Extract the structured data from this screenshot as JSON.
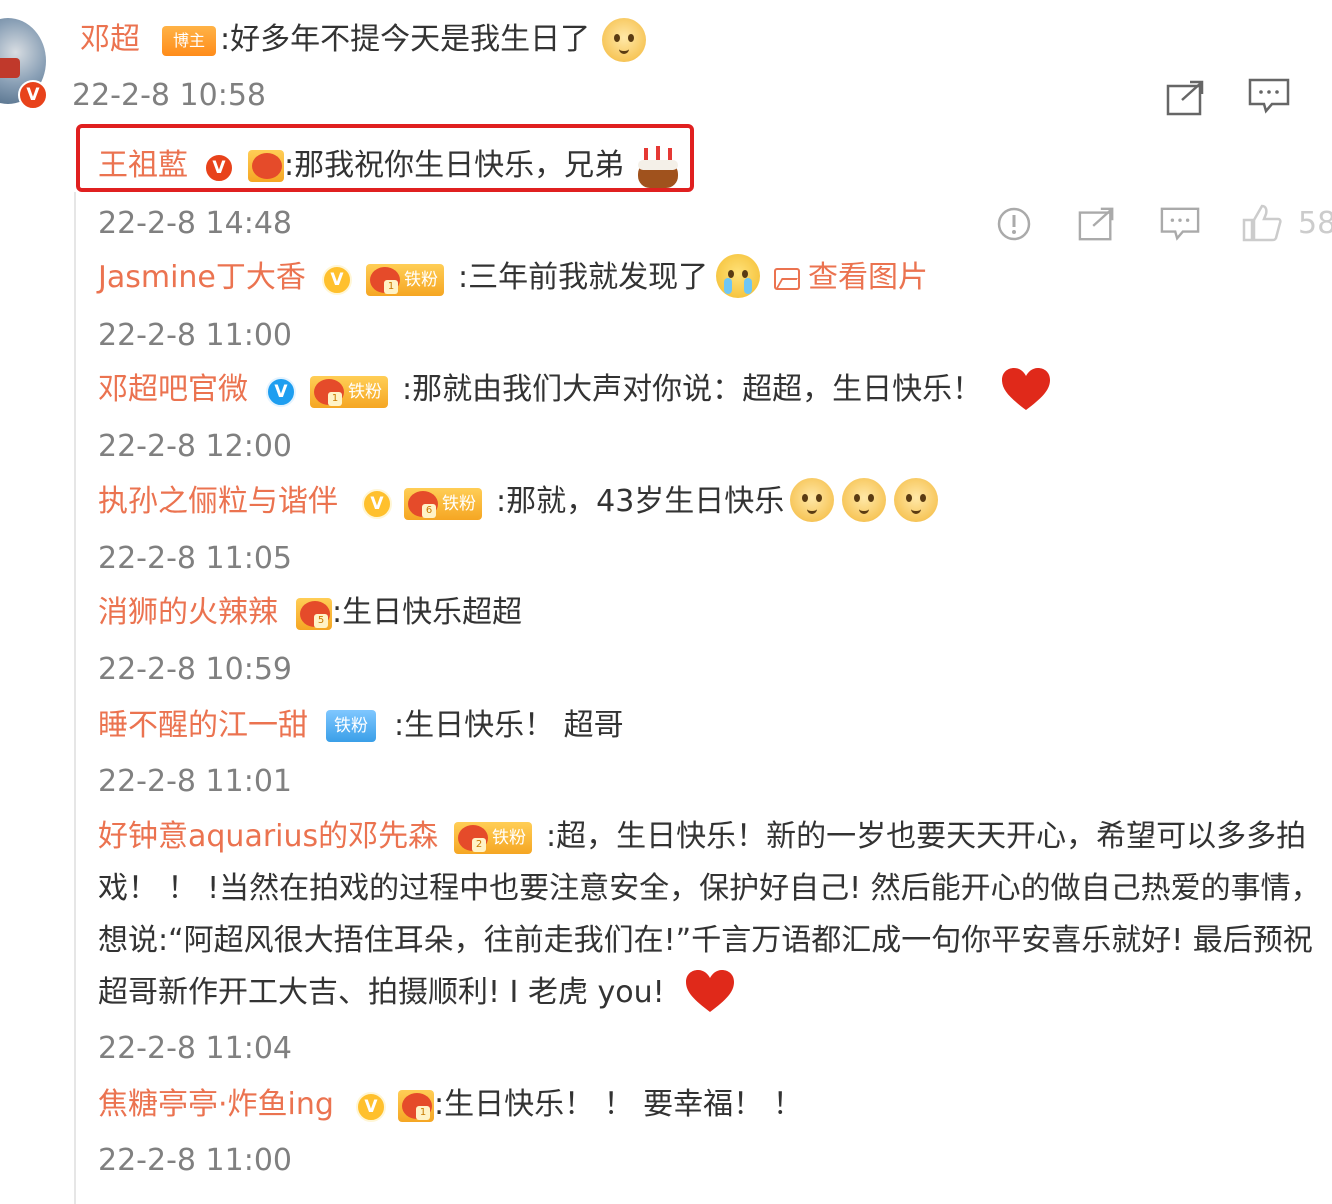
{
  "main_post": {
    "author": "邓超",
    "badge": "博主",
    "text": ":好多年不提今天是我生日了",
    "time": "22-2-8 10:58"
  },
  "highlight_reply": {
    "author": "王祖藍",
    "text": ":那我祝你生日快乐，兄弟",
    "time": "22-2-8 14:48",
    "like_count": "58"
  },
  "replies": [
    {
      "author": "Jasmine丁大香",
      "fan_badge": "铁粉",
      "fan_level": "1",
      "text": ":三年前我就发现了",
      "link": "查看图片",
      "time": "22-2-8 11:00"
    },
    {
      "author": "邓超吧官微",
      "fan_badge": "铁粉",
      "fan_level": "1",
      "text": ":那就由我们大声对你说：超超，生日快乐！",
      "time": "22-2-8 12:00"
    },
    {
      "author": "执孙之俪粒与谐伴",
      "fan_badge": "铁粉",
      "fan_level": "6",
      "text": ":那就，43岁生日快乐",
      "time": "22-2-8 11:05"
    },
    {
      "author": "消狮的火辣辣",
      "fan_level": "5",
      "text": ":生日快乐超超",
      "time": "22-2-8 10:59"
    },
    {
      "author": "睡不醒的江一甜",
      "fan_badge": "铁粉",
      "text": ":生日快乐！ 超哥",
      "time": "22-2-8 11:01"
    },
    {
      "author": "好钟意aquarius的邓先森",
      "fan_badge": "铁粉",
      "fan_level": "2",
      "text_lines": [
        ":超，生日快乐！新的一岁也要天天开心，希望可以多多拍",
        "戏！ ！ !当然在拍戏的过程中也要注意安全，保护好自己! 然后能开心的做自己热爱的事情，",
        "想说:“阿超风很大捂住耳朵，往前走我们在!”千言万语都汇成一句你平安喜乐就好! 最后预祝",
        "超哥新作开工大吉、拍摄顺利! I 老虎 you!"
      ],
      "time": "22-2-8 11:04"
    },
    {
      "author": "焦糖亭亭·炸鱼ing",
      "fan_level": "1",
      "text": ":生日快乐！ ！ 要幸福！ ！",
      "time": "22-2-8 11:00"
    }
  ],
  "icons": [
    "share-icon",
    "comment-icon",
    "report-icon",
    "like-icon",
    "image-icon"
  ],
  "colors": {
    "username": "#eb7350",
    "highlight_border": "#e02020",
    "text": "#333333",
    "time": "#808080"
  }
}
